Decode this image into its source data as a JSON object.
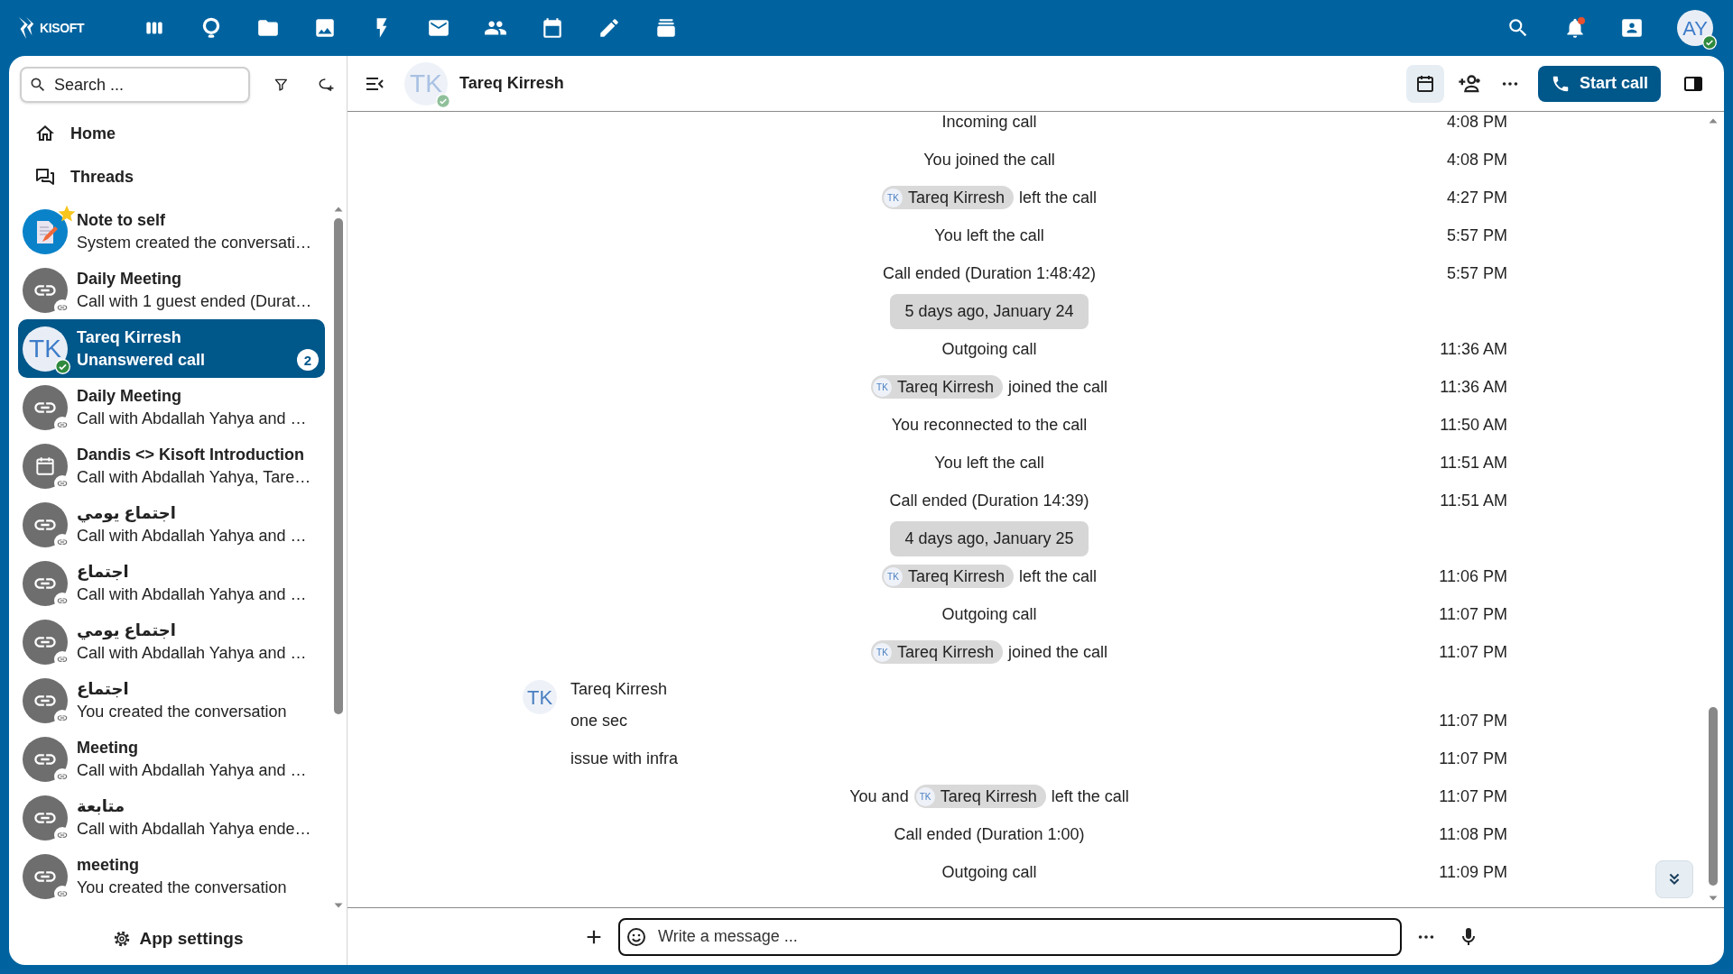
{
  "top_bar": {
    "logo": "KISOFT",
    "notifications_unread": true,
    "user": {
      "initials": "AY",
      "online": true
    }
  },
  "sidebar": {
    "search": {
      "placeholder": "Search ..."
    },
    "nav": [
      {
        "kind": "home",
        "label": "Home"
      },
      {
        "kind": "threads",
        "label": "Threads"
      }
    ],
    "conversations": [
      {
        "name": "Note to self",
        "preview": "System created the conversati…",
        "kind": "note",
        "online": false,
        "favorite": true,
        "selected": false
      },
      {
        "name": "Daily Meeting",
        "preview": "Call with 1 guest ended (Durat…",
        "kind": "link",
        "online": false,
        "favorite": false,
        "selected": false
      },
      {
        "name": "Tareq Kirresh",
        "preview": "Unanswered call",
        "kind": "person",
        "initials": "TK",
        "online": true,
        "favorite": false,
        "selected": true,
        "unread": "2"
      },
      {
        "name": "Daily Meeting",
        "preview": "Call with Abdallah Yahya and …",
        "kind": "link",
        "online": false,
        "favorite": false,
        "selected": false
      },
      {
        "name": "Dandis <> Kisoft Introduction",
        "preview": "Call with Abdallah Yahya, Tare…",
        "kind": "calendar",
        "online": false,
        "favorite": false,
        "selected": false
      },
      {
        "name": "اجتماع يومي",
        "preview": "Call with Abdallah Yahya and …",
        "kind": "link",
        "online": false,
        "favorite": false,
        "selected": false
      },
      {
        "name": "اجتماع",
        "preview": "Call with Abdallah Yahya and …",
        "kind": "link",
        "online": false,
        "favorite": false,
        "selected": false
      },
      {
        "name": "اجتماع يومي",
        "preview": "Call with Abdallah Yahya and …",
        "kind": "link",
        "online": false,
        "favorite": false,
        "selected": false
      },
      {
        "name": "اجتماع",
        "preview": "You created the conversation",
        "kind": "link",
        "online": false,
        "favorite": false,
        "selected": false
      },
      {
        "name": "Meeting",
        "preview": "Call with Abdallah Yahya and …",
        "kind": "link",
        "online": false,
        "favorite": false,
        "selected": false
      },
      {
        "name": "متابعة",
        "preview": "Call with Abdallah Yahya ende…",
        "kind": "link",
        "online": false,
        "favorite": false,
        "selected": false
      },
      {
        "name": "meeting",
        "preview": "You created the conversation",
        "kind": "link",
        "online": false,
        "favorite": false,
        "selected": false
      }
    ],
    "app_settings": "App settings"
  },
  "chat": {
    "header": {
      "initials": "TK",
      "name": "Tareq Kirresh",
      "online": true,
      "start_call": "Start call"
    },
    "messages": [
      {
        "kind": "system",
        "text": "Incoming call",
        "time": "4:08 PM"
      },
      {
        "kind": "system",
        "text": "You joined the call",
        "time": "4:08 PM"
      },
      {
        "kind": "mention",
        "initials": "TK",
        "name": "Tareq Kirresh",
        "after": "left the call",
        "time": "4:27 PM"
      },
      {
        "kind": "system",
        "text": "You left the call",
        "time": "5:57 PM"
      },
      {
        "kind": "system",
        "text": "Call ended (Duration 1:48:42)",
        "time": "5:57 PM"
      },
      {
        "kind": "date",
        "text": "5 days ago, January 24"
      },
      {
        "kind": "system",
        "text": "Outgoing call",
        "time": "11:36 AM"
      },
      {
        "kind": "mention",
        "initials": "TK",
        "name": "Tareq Kirresh",
        "after": "joined the call",
        "time": "11:36 AM"
      },
      {
        "kind": "system",
        "text": "You reconnected to the call",
        "time": "11:50 AM"
      },
      {
        "kind": "system",
        "text": "You left the call",
        "time": "11:51 AM"
      },
      {
        "kind": "system",
        "text": "Call ended (Duration 14:39)",
        "time": "11:51 AM"
      },
      {
        "kind": "date",
        "text": "4 days ago, January 25"
      },
      {
        "kind": "mention",
        "initials": "TK",
        "name": "Tareq Kirresh",
        "after": "left the call",
        "time": "11:06 PM"
      },
      {
        "kind": "system",
        "text": "Outgoing call",
        "time": "11:07 PM"
      },
      {
        "kind": "mention",
        "initials": "TK",
        "name": "Tareq Kirresh",
        "after": "joined the call",
        "time": "11:07 PM"
      },
      {
        "kind": "author",
        "initials": "TK",
        "name": "Tareq Kirresh"
      },
      {
        "kind": "text",
        "text": "one sec",
        "time": "11:07 PM"
      },
      {
        "kind": "text",
        "text": "issue with infra",
        "time": "11:07 PM"
      },
      {
        "kind": "mention",
        "before": "You and",
        "initials": "TK",
        "name": "Tareq Kirresh",
        "after": "left the call",
        "time": "11:07 PM"
      },
      {
        "kind": "system",
        "text": "Call ended (Duration 1:00)",
        "time": "11:08 PM"
      },
      {
        "kind": "system",
        "text": "Outgoing call",
        "time": "11:09 PM"
      }
    ],
    "composer": {
      "placeholder": "Write a message ..."
    }
  }
}
